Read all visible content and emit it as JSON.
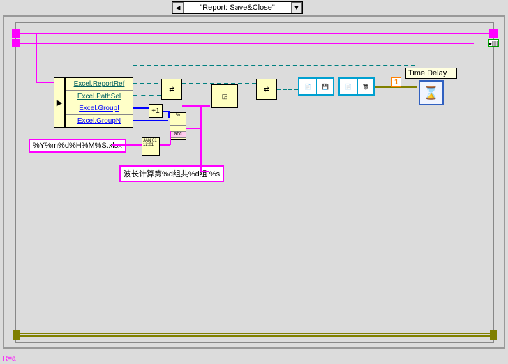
{
  "case_selector": {
    "left_arrow": "◀",
    "label": "\"Report: Save&Close\"",
    "right_arrow": "▼"
  },
  "cluster": {
    "rows": [
      "Excel.ReportRef",
      "Excel.PathSel",
      "Excel.GroupI",
      "Excel.GroupN"
    ]
  },
  "strings": {
    "filename_format": "%Y%m%d%H%M%S.xlsx",
    "caption_format": "波长计算第%d组共%d组 %s"
  },
  "increment": {
    "label": "+1"
  },
  "time_delay": {
    "label": "Time Delay",
    "icon": "⌛"
  },
  "one_const": {
    "value": "1"
  },
  "nodes": {
    "bundle1": "⇄",
    "bundle2": "⇄",
    "transform": "◲",
    "save": "💾",
    "close": "🗑",
    "timestamp": "JAN\n01\n12:01"
  },
  "tunnel_green": "▸||||",
  "footer": "R=a"
}
